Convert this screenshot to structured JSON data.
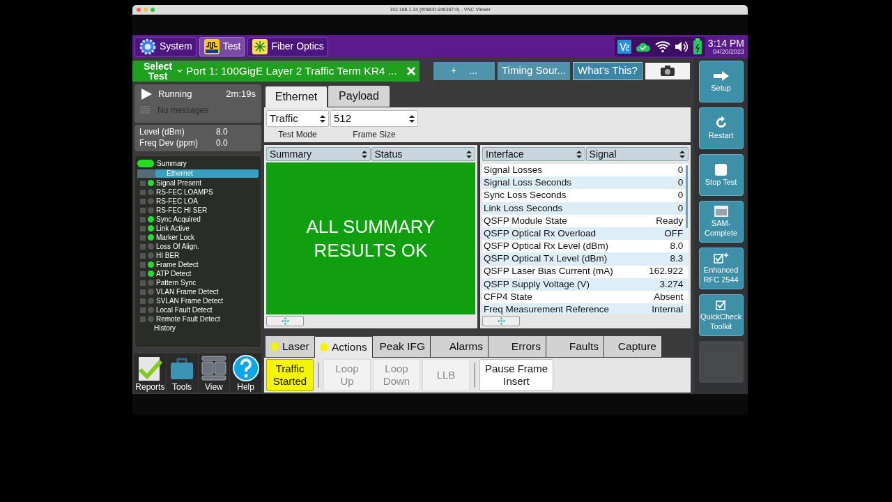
{
  "window": {
    "title": "192.168.1.34 (tb5800-946387:0) - VNC Viewer"
  },
  "top_bar": {
    "buttons": [
      {
        "label": "System",
        "selected": false,
        "kind": "gear"
      },
      {
        "label": "Test",
        "selected": true,
        "kind": "bert"
      },
      {
        "label": "Fiber Optics",
        "selected": false,
        "kind": "fiber"
      }
    ],
    "time": "3:14 PM",
    "date": "04/20/2023"
  },
  "tab_bar": {
    "select_test": "Select Test",
    "active_tab": "Port 1: 100GigE Layer 2 Traffic Term KR4 ...",
    "add_tab": "+",
    "more_tab": "...",
    "tabs": [
      "Timing Sour...",
      "What's This?"
    ]
  },
  "status": {
    "state": "Running",
    "elapsed": "2m:19s",
    "messages": "No messages",
    "readings": [
      {
        "label": "Level (dBm)",
        "value": "8.0"
      },
      {
        "label": "Freq Dev (ppm)",
        "value": "0.0"
      }
    ]
  },
  "tree": {
    "summary": "Summary",
    "group": "Ethernet",
    "items": [
      {
        "label": "Signal Present",
        "on": true
      },
      {
        "label": "RS-FEC LOAMPS",
        "on": false
      },
      {
        "label": "RS-FEC LOA",
        "on": false
      },
      {
        "label": "RS-FEC HI SER",
        "on": false
      },
      {
        "label": "Sync Acquired",
        "on": true
      },
      {
        "label": "Link Active",
        "on": true
      },
      {
        "label": "Marker Lock",
        "on": true
      },
      {
        "label": "Loss Of Align.",
        "on": false
      },
      {
        "label": "HI BER",
        "on": false
      },
      {
        "label": "Frame Detect",
        "on": true
      },
      {
        "label": "ATP Detect",
        "on": true
      },
      {
        "label": "Pattern Sync",
        "on": false
      },
      {
        "label": "VLAN Frame Detect",
        "on": false
      },
      {
        "label": "SVLAN Frame Detect",
        "on": false
      },
      {
        "label": "Local Fault Detect",
        "on": false
      },
      {
        "label": "Remote Fault Detect",
        "on": false
      }
    ],
    "history": "History"
  },
  "tools": [
    {
      "label": "Reports",
      "kind": "reports"
    },
    {
      "label": "Tools",
      "kind": "tools"
    },
    {
      "label": "View",
      "kind": "view"
    },
    {
      "label": "Help",
      "kind": "help"
    }
  ],
  "result_tabs": [
    {
      "label": "Ethernet",
      "selected": true
    },
    {
      "label": "Payload",
      "selected": false
    }
  ],
  "settings": [
    {
      "value": "Traffic",
      "label": "Test Mode"
    },
    {
      "value": "512",
      "label": "Frame Size"
    }
  ],
  "left_pane": {
    "selectors": [
      "Summary",
      "Status"
    ],
    "message": "ALL SUMMARY RESULTS OK"
  },
  "right_pane": {
    "selectors": [
      "Interface",
      "Signal"
    ],
    "rows": [
      {
        "label": "Signal Losses",
        "value": "0"
      },
      {
        "label": "Signal Loss Seconds",
        "value": "0"
      },
      {
        "label": "Sync Loss Seconds",
        "value": "0"
      },
      {
        "label": "Link Loss Seconds",
        "value": "0"
      },
      {
        "label": "QSFP Module State",
        "value": "Ready"
      },
      {
        "label": "QSFP Optical Rx Overload",
        "value": "OFF"
      },
      {
        "label": "QSFP Optical Rx Level (dBm)",
        "value": "8.0"
      },
      {
        "label": "QSFP Optical Tx Level (dBm)",
        "value": "8.3"
      },
      {
        "label": "QSFP Laser Bias Current (mA)",
        "value": "162.922"
      },
      {
        "label": "QSFP Supply Voltage (V)",
        "value": "3.274"
      },
      {
        "label": "CFP4 State",
        "value": "Absent"
      },
      {
        "label": "Freq Measurement Reference",
        "value": "Internal"
      }
    ]
  },
  "action_tabs": [
    {
      "label": "Laser",
      "selected": false,
      "led": true
    },
    {
      "label": "Actions",
      "selected": true,
      "led": true
    },
    {
      "label": "Peak IFG",
      "selected": false,
      "led": false
    },
    {
      "label": "Alarms",
      "selected": false,
      "led": false
    },
    {
      "label": "Errors",
      "selected": false,
      "led": false
    },
    {
      "label": "Faults",
      "selected": false,
      "led": false
    },
    {
      "label": "Capture",
      "selected": false,
      "led": false
    }
  ],
  "actions": [
    {
      "label": "Traffic Started",
      "on": true,
      "disabled": false
    },
    {
      "label": "Loop Up",
      "on": false,
      "disabled": true
    },
    {
      "label": "Loop Down",
      "on": false,
      "disabled": true
    },
    {
      "label": "LLB",
      "on": false,
      "disabled": true
    },
    {
      "label": "Pause Frame Insert",
      "on": false,
      "disabled": false
    }
  ],
  "side_buttons": [
    {
      "label": "Setup",
      "kind": "arrow"
    },
    {
      "label": "Restart",
      "kind": "restart"
    },
    {
      "label": "Stop Test",
      "kind": "stop"
    },
    {
      "label": "SAM-Complete",
      "kind": "window"
    },
    {
      "label": "Enhanced RFC 2544",
      "kind": "check-plus"
    },
    {
      "label": "QuickCheck Toolkit",
      "kind": "check"
    },
    {
      "kind": "empty"
    }
  ]
}
